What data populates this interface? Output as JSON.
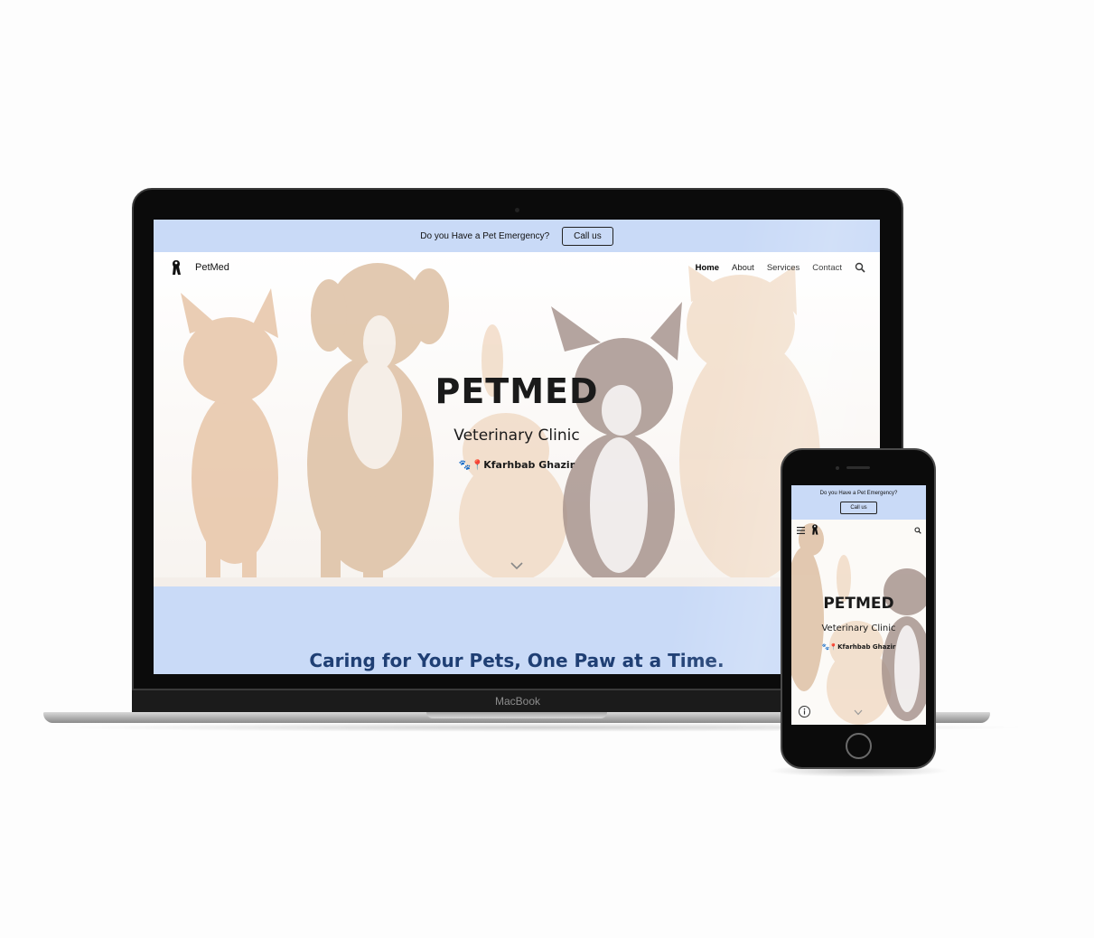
{
  "laptop": {
    "brand": "MacBook",
    "emergency_bar": {
      "text": "Do you Have a Pet Emergency?",
      "button_label": "Call us"
    },
    "navbar": {
      "logo_text": "PetMed",
      "links": [
        {
          "label": "Home",
          "active": true
        },
        {
          "label": "About",
          "active": false
        },
        {
          "label": "Services",
          "active": false
        },
        {
          "label": "Contact",
          "active": false
        }
      ],
      "search_icon": "search-icon"
    },
    "hero": {
      "title": "PETMED",
      "subtitle": "Veterinary Clinic",
      "location": "🐾📍Kfarhbab Ghazir",
      "scroll_icon": "chevron-down-icon"
    },
    "tagline": "Caring for Your Pets, One Paw at a Time."
  },
  "phone": {
    "emergency_bar": {
      "text": "Do you Have a Pet Emergency?",
      "button_label": "Call us"
    },
    "navbar": {
      "menu_icon": "hamburger-menu-icon",
      "search_icon": "search-icon"
    },
    "hero": {
      "title": "PETMED",
      "subtitle": "Veterinary Clinic",
      "location": "🐾📍Kfarhbab Ghazir",
      "info_icon": "info-icon",
      "scroll_icon": "chevron-down-icon"
    }
  },
  "colors": {
    "accent_bar": "#c9daf7",
    "tagline_text": "#1f3f74",
    "text_dark": "#1a1a1a"
  }
}
